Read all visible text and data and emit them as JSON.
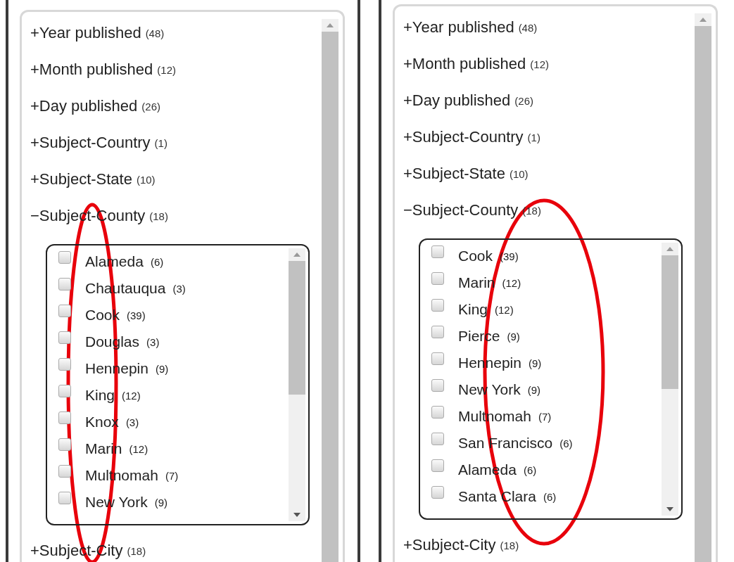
{
  "panels": [
    {
      "facets": [
        {
          "toggle": "+",
          "label": "Year published",
          "count": "(48)"
        },
        {
          "toggle": "+",
          "label": "Month published",
          "count": "(12)"
        },
        {
          "toggle": "+",
          "label": "Day published",
          "count": "(26)"
        },
        {
          "toggle": "+",
          "label": "Subject-Country",
          "count": "(1)"
        },
        {
          "toggle": "+",
          "label": "Subject-State",
          "count": "(10)"
        },
        {
          "toggle": "−",
          "label": "Subject-County",
          "count": "(18)",
          "items": [
            {
              "label": "Alameda",
              "count": "(6)",
              "checked": false
            },
            {
              "label": "Chautauqua",
              "count": "(3)",
              "checked": false
            },
            {
              "label": "Cook",
              "count": "(39)",
              "checked": false
            },
            {
              "label": "Douglas",
              "count": "(3)",
              "checked": false
            },
            {
              "label": "Hennepin",
              "count": "(9)",
              "checked": false
            },
            {
              "label": "King",
              "count": "(12)",
              "checked": false
            },
            {
              "label": "Knox",
              "count": "(3)",
              "checked": false
            },
            {
              "label": "Marin",
              "count": "(12)",
              "checked": false
            },
            {
              "label": "Multnomah",
              "count": "(7)",
              "checked": false
            },
            {
              "label": "New York",
              "count": "(9)",
              "checked": false
            }
          ]
        },
        {
          "toggle": "+",
          "label": "Subject-City",
          "count": "(18)"
        }
      ]
    },
    {
      "facets": [
        {
          "toggle": "+",
          "label": "Year published",
          "count": "(48)"
        },
        {
          "toggle": "+",
          "label": "Month published",
          "count": "(12)"
        },
        {
          "toggle": "+",
          "label": "Day published",
          "count": "(26)"
        },
        {
          "toggle": "+",
          "label": "Subject-Country",
          "count": "(1)"
        },
        {
          "toggle": "+",
          "label": "Subject-State",
          "count": "(10)"
        },
        {
          "toggle": "−",
          "label": "Subject-County",
          "count": "(18)",
          "items": [
            {
              "label": "Cook",
              "count": "(39)",
              "checked": false
            },
            {
              "label": "Marin",
              "count": "(12)",
              "checked": false
            },
            {
              "label": "King",
              "count": "(12)",
              "checked": false
            },
            {
              "label": "Pierce",
              "count": "(9)",
              "checked": false
            },
            {
              "label": "Hennepin",
              "count": "(9)",
              "checked": false
            },
            {
              "label": "New York",
              "count": "(9)",
              "checked": false
            },
            {
              "label": "Multnomah",
              "count": "(7)",
              "checked": false
            },
            {
              "label": "San Francisco",
              "count": "(6)",
              "checked": false
            },
            {
              "label": "Alameda",
              "count": "(6)",
              "checked": false
            },
            {
              "label": "Santa Clara",
              "count": "(6)",
              "checked": false
            }
          ]
        },
        {
          "toggle": "+",
          "label": "Subject-City",
          "count": "(18)"
        }
      ]
    }
  ]
}
